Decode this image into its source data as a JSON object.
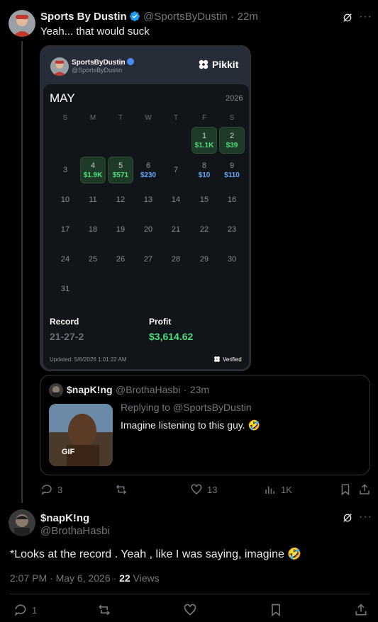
{
  "post1": {
    "display_name": "Sports By Dustin",
    "handle": "@SportsByDustin",
    "time": "22m",
    "text": "Yeah... that would suck",
    "stats": {
      "replies": "3",
      "likes": "13",
      "views": "1K"
    }
  },
  "card": {
    "display_name": "SportsByDustin",
    "handle": "@SportsByDustin",
    "brand": "Pikkit",
    "month": "MAY",
    "year": "2026",
    "dow": [
      "S",
      "M",
      "T",
      "W",
      "T",
      "F",
      "S"
    ],
    "days": [
      {
        "d": "1",
        "amt": "$1.1K",
        "color": "green",
        "win": true
      },
      {
        "d": "2",
        "amt": "$39",
        "color": "green",
        "win": true
      },
      {
        "d": "3",
        "amt": "",
        "color": "",
        "win": false
      },
      {
        "d": "4",
        "amt": "$1.9K",
        "color": "green",
        "win": true
      },
      {
        "d": "5",
        "amt": "$571",
        "color": "green",
        "win": true
      },
      {
        "d": "6",
        "amt": "$230",
        "color": "blue",
        "win": false
      },
      {
        "d": "7",
        "amt": "",
        "color": "",
        "win": false
      },
      {
        "d": "8",
        "amt": "$10",
        "color": "blue",
        "win": false
      },
      {
        "d": "9",
        "amt": "$110",
        "color": "blue",
        "win": false
      },
      {
        "d": "10",
        "amt": "",
        "color": "",
        "win": false
      },
      {
        "d": "11",
        "amt": "",
        "color": "",
        "win": false
      },
      {
        "d": "12",
        "amt": "",
        "color": "",
        "win": false
      },
      {
        "d": "13",
        "amt": "",
        "color": "",
        "win": false
      },
      {
        "d": "14",
        "amt": "",
        "color": "",
        "win": false
      },
      {
        "d": "15",
        "amt": "",
        "color": "",
        "win": false
      },
      {
        "d": "16",
        "amt": "",
        "color": "",
        "win": false
      },
      {
        "d": "17",
        "amt": "",
        "color": "",
        "win": false
      },
      {
        "d": "18",
        "amt": "",
        "color": "",
        "win": false
      },
      {
        "d": "19",
        "amt": "",
        "color": "",
        "win": false
      },
      {
        "d": "20",
        "amt": "",
        "color": "",
        "win": false
      },
      {
        "d": "21",
        "amt": "",
        "color": "",
        "win": false
      },
      {
        "d": "22",
        "amt": "",
        "color": "",
        "win": false
      },
      {
        "d": "23",
        "amt": "",
        "color": "",
        "win": false
      },
      {
        "d": "24",
        "amt": "",
        "color": "",
        "win": false
      },
      {
        "d": "25",
        "amt": "",
        "color": "",
        "win": false
      },
      {
        "d": "26",
        "amt": "",
        "color": "",
        "win": false
      },
      {
        "d": "27",
        "amt": "",
        "color": "",
        "win": false
      },
      {
        "d": "28",
        "amt": "",
        "color": "",
        "win": false
      },
      {
        "d": "29",
        "amt": "",
        "color": "",
        "win": false
      },
      {
        "d": "30",
        "amt": "",
        "color": "",
        "win": false
      },
      {
        "d": "31",
        "amt": "",
        "color": "",
        "win": false
      }
    ],
    "record_label": "Record",
    "record_value": "21-27-2",
    "profit_label": "Profit",
    "profit_value": "$3,614.62",
    "updated": "Updated: 5/6/2026 1:01:22 AM",
    "verified": "Verified"
  },
  "quote": {
    "display_name": "$napK!ng",
    "handle": "@BrothaHasbi",
    "time": "23m",
    "replying": "Replying to @SportsByDustin",
    "text": "Imagine listening to this guy. 🤣",
    "gif_label": "GIF"
  },
  "post2": {
    "display_name": "$napK!ng",
    "handle": "@BrothaHasbi",
    "text": "*Looks at the record . Yeah , like I was saying, imagine 🤣",
    "timestamp": "2:07 PM · May 6, 2026 · ",
    "views_count": "22",
    "views_label": "Views",
    "stats": {
      "replies": "1"
    }
  },
  "colors": {
    "accent_green": "#4ade80",
    "accent_blue": "#1d9bf0",
    "bg": "#000000"
  }
}
